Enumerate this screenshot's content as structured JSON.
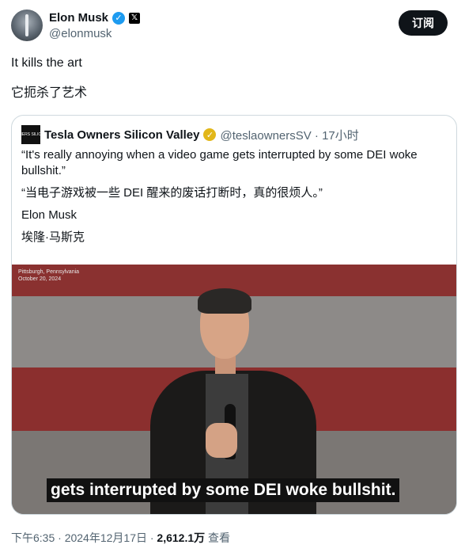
{
  "author": {
    "name": "Elon Musk",
    "handle": "@elonmusk",
    "verified_mark": "✓",
    "affiliate_badge": "𝕏"
  },
  "subscribe_label": "订阅",
  "tweet": {
    "line1": "It kills the art",
    "line2": "它扼杀了艺术"
  },
  "quote": {
    "author_name": "Tesla Owners Silicon Valley",
    "avatar_text": "TESLA OWNERS SILICON VALLEY",
    "verified_mark": "✓",
    "handle_time": "@teslaownersSV · 17小时",
    "text_en": "“It's really annoying when a video game gets interrupted by some DEI woke bullshit.”",
    "text_zh": "“当电子游戏被一些 DEI 醒来的废话打断时，真的很烦人。”",
    "attribution_en": "Elon Musk",
    "attribution_zh": "埃隆·马斯克"
  },
  "media": {
    "location_line1": "Pittsburgh, Pennsylvania",
    "location_line2": "October 20, 2024",
    "caption": "gets interrupted by some DEI woke bullshit."
  },
  "footer": {
    "time_date": "下午6:35 · 2024年12月17日 · ",
    "views": "2,612.1万",
    "views_label": " 查看"
  },
  "colors": {
    "verified_blue": "#1d9bf0",
    "gold_badge": "#e2b719",
    "button_bg": "#0f1419",
    "secondary_text": "#536471"
  }
}
